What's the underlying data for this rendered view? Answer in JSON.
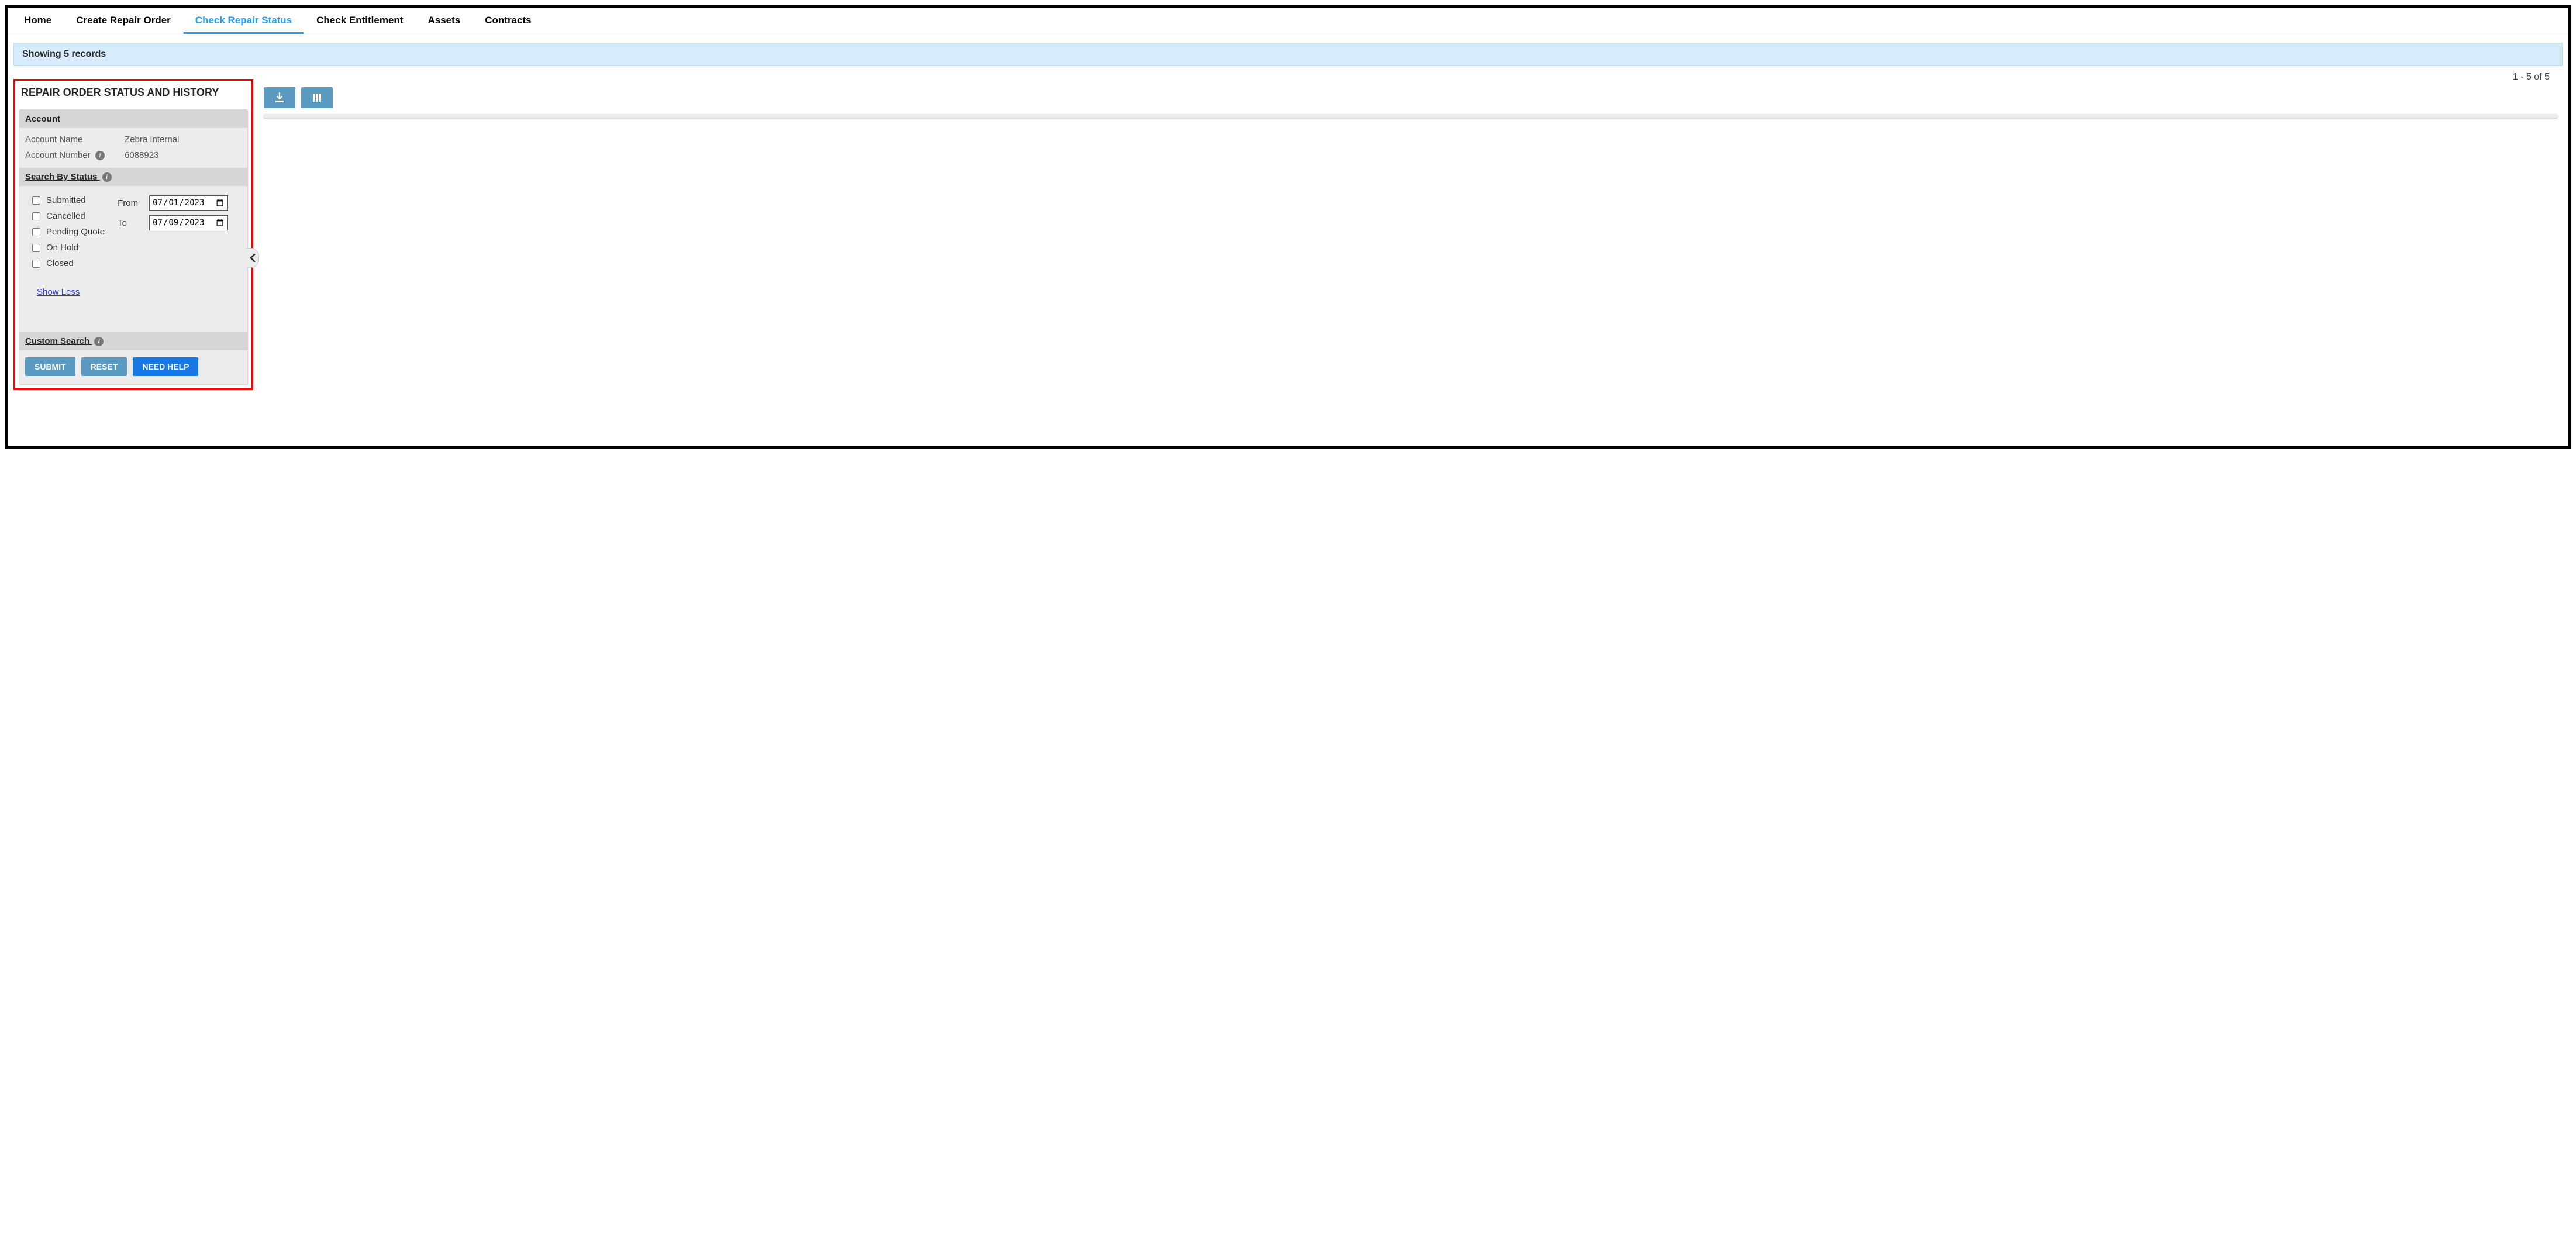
{
  "nav": {
    "items": [
      {
        "label": "Home",
        "active": false
      },
      {
        "label": "Create Repair Order",
        "active": false
      },
      {
        "label": "Check Repair Status",
        "active": true
      },
      {
        "label": "Check Entitlement",
        "active": false
      },
      {
        "label": "Assets",
        "active": false
      },
      {
        "label": "Contracts",
        "active": false
      }
    ]
  },
  "status_bar": "Showing 5 records",
  "pagination": "1 - 5 of 5",
  "sidebar": {
    "title": "REPAIR ORDER STATUS AND HISTORY",
    "account": {
      "header": "Account",
      "name_label": "Account Name",
      "name_value": "Zebra Internal",
      "number_label": "Account Number",
      "number_value": "6088923"
    },
    "search_status": {
      "header": "Search By Status",
      "options": [
        "Submitted",
        "Cancelled",
        "Pending Quote",
        "On Hold",
        "Closed"
      ],
      "from_label": "From",
      "from_value": "2023-07-01",
      "from_display": "07/01/2023",
      "to_label": "To",
      "to_value": "2023-07-09",
      "to_display": "07/09/2023",
      "show_less": "Show Less"
    },
    "custom_search": {
      "header": "Custom Search"
    },
    "buttons": {
      "submit": "SUBMIT",
      "reset": "RESET",
      "help": "NEED HELP"
    }
  }
}
